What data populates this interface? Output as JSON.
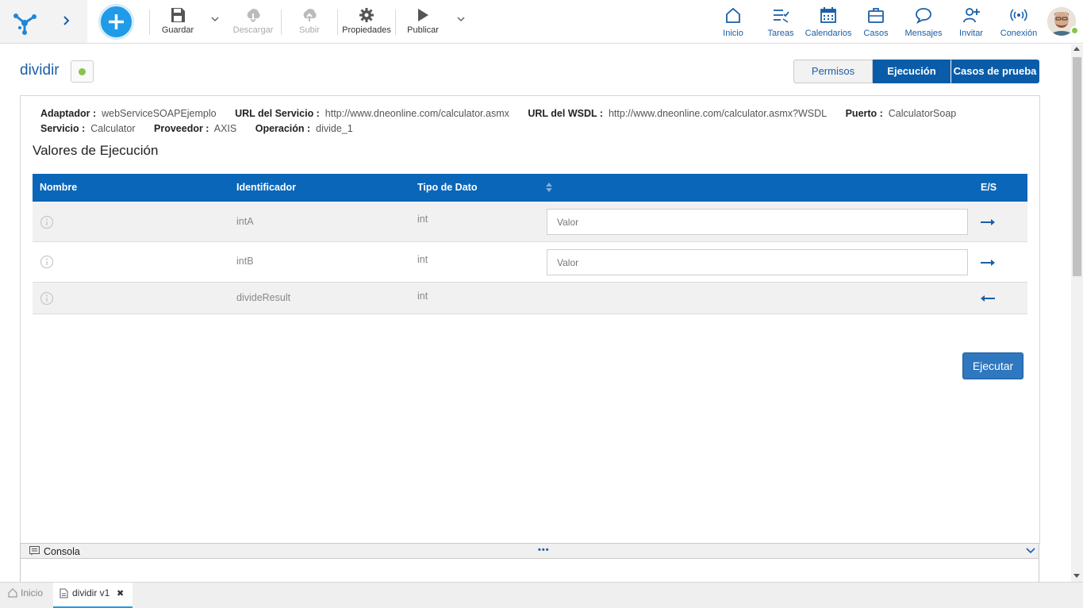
{
  "toolbar": {
    "save_label": "Guardar",
    "download_label": "Descargar",
    "upload_label": "Subir",
    "properties_label": "Propiedades",
    "publish_label": "Publicar"
  },
  "nav": {
    "home": "Inicio",
    "tasks": "Tareas",
    "calendars": "Calendarios",
    "cases": "Casos",
    "messages": "Mensajes",
    "invite": "Invitar",
    "connection": "Conexión"
  },
  "page": {
    "title": "dividir",
    "tabs": [
      "Permisos",
      "Ejecución",
      "Casos de prueba"
    ]
  },
  "meta": {
    "adapter_label": "Adaptador :",
    "adapter_value": "webServiceSOAPEjemplo",
    "url_label": "URL del Servicio :",
    "url_value": "http://www.dneonline.com/calculator.asmx",
    "wsdl_label": "URL del WSDL :",
    "wsdl_value": "http://www.dneonline.com/calculator.asmx?WSDL",
    "port_label": "Puerto :",
    "port_value": "CalculatorSoap",
    "service_label": "Servicio :",
    "service_value": "Calculator",
    "provider_label": "Proveedor :",
    "provider_value": "AXIS",
    "operation_label": "Operación :",
    "operation_value": "divide_1"
  },
  "section_title": "Valores de Ejecución",
  "table": {
    "headers": {
      "name": "Nombre",
      "identifier": "Identificador",
      "type": "Tipo de Dato",
      "io": "E/S"
    },
    "rows": [
      {
        "identifier": "intA",
        "type": "int",
        "placeholder": "Valor",
        "direction": "in"
      },
      {
        "identifier": "intB",
        "type": "int",
        "placeholder": "Valor",
        "direction": "in"
      },
      {
        "identifier": "divideResult",
        "type": "int",
        "direction": "out"
      }
    ]
  },
  "run_button": "Ejecutar",
  "console": {
    "label": "Consola",
    "dots": "•••"
  },
  "bottom_tabs": {
    "home": "Inicio",
    "doc": "dividir v1",
    "close": "✖"
  },
  "colors": {
    "brand": "#0a5ca8",
    "accent": "#1f9be8",
    "status": "#8bc34a"
  }
}
